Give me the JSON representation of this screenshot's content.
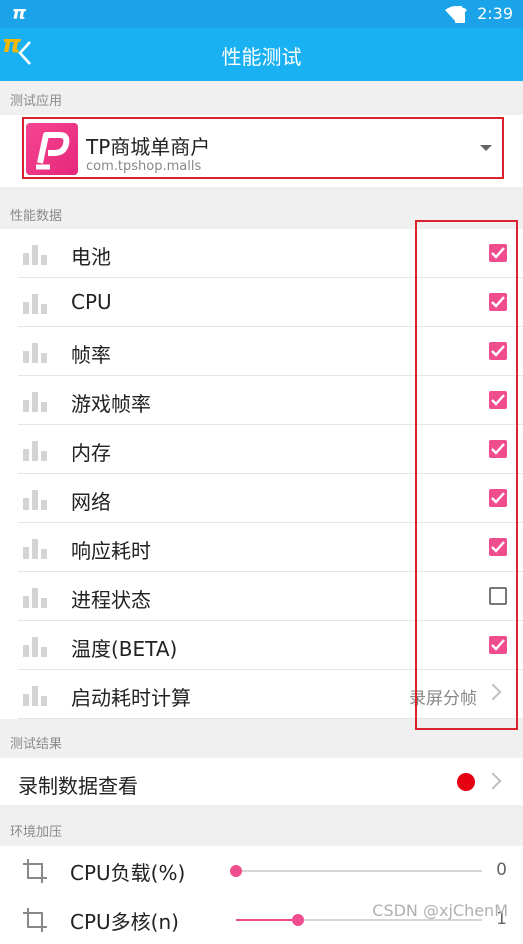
{
  "status": {
    "app_glyph": "π",
    "time": "2:39"
  },
  "appbar": {
    "logo": "π",
    "title": "性能测试"
  },
  "sections": {
    "app": "测试应用",
    "perf": "性能数据",
    "results": "测试结果",
    "env": "环境加压"
  },
  "app_select": {
    "name": "TP商城单商户",
    "package": "com.tpshop.malls"
  },
  "perf_items": [
    {
      "label": "电池",
      "checked": true
    },
    {
      "label": "CPU",
      "checked": true
    },
    {
      "label": "帧率",
      "checked": true
    },
    {
      "label": "游戏帧率",
      "checked": true
    },
    {
      "label": "内存",
      "checked": true
    },
    {
      "label": "网络",
      "checked": true
    },
    {
      "label": "响应耗时",
      "checked": true
    },
    {
      "label": "进程状态",
      "checked": false
    },
    {
      "label": "温度(BETA)",
      "checked": true
    },
    {
      "label": "启动耗时计算",
      "value": "录屏分帧"
    }
  ],
  "results": {
    "record_label": "录制数据查看"
  },
  "env_items": [
    {
      "label": "CPU负载(%)",
      "value": "0",
      "fraction": 0.0
    },
    {
      "label": "CPU多核(n)",
      "value": "1",
      "fraction": 0.25
    }
  ],
  "watermark": "CSDN @xjChenM",
  "colors": {
    "appbar": "#1ab1f3",
    "accent": "#f04d8e",
    "record": "#e60012",
    "highlight": "#d9232d"
  }
}
